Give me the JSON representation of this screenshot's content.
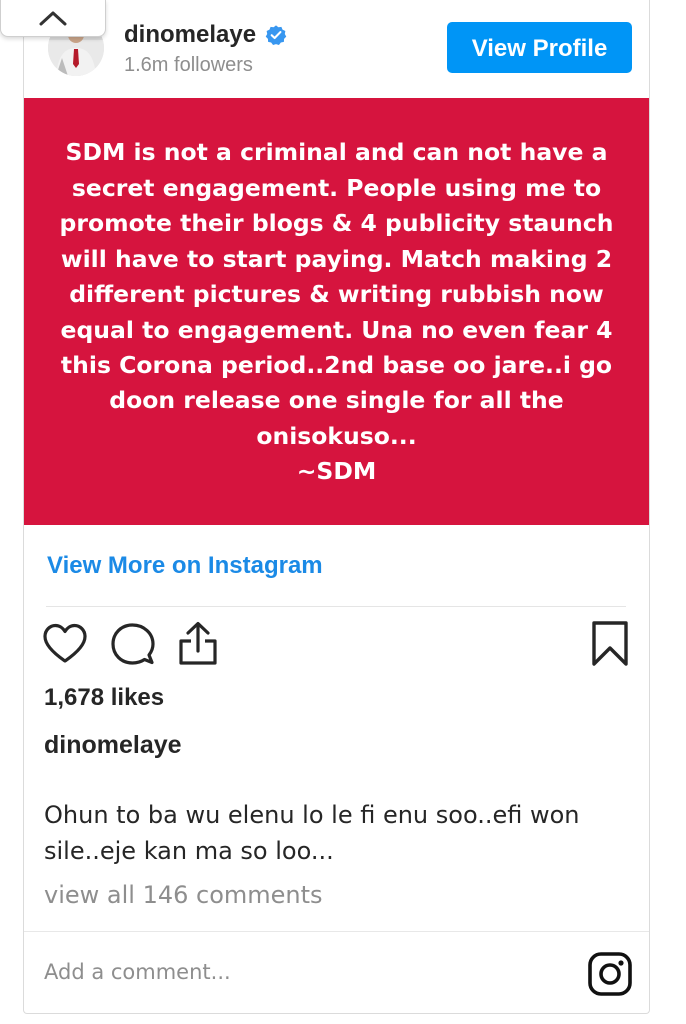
{
  "header": {
    "username": "dinomelaye",
    "followers": "1.6m followers",
    "view_profile_label": "View Profile"
  },
  "post": {
    "image_text_lines": [
      "SDM is not a criminal and can not have a",
      "secret engagement. People using me to",
      "promote their blogs & 4 publicity staunch",
      "will have to start paying. Match making 2",
      "different pictures & writing rubbish now",
      "equal to engagement. Una no even fear 4",
      "this Corona period..2nd base oo jare..i go",
      "doon release one single for all the",
      "onisokuso...",
      "~SDM"
    ],
    "image_background": "#d6143e",
    "view_more_label": "View More on Instagram",
    "likes": "1,678 likes",
    "caption_username": "dinomelaye",
    "caption_text": "Ohun to ba wu elenu lo le fi enu soo..efi won sile..eje kan ma so loo...",
    "view_comments": "view all 146 comments"
  },
  "comment_box": {
    "placeholder": "Add a comment..."
  },
  "icons": {
    "collapse": "chevron-up-icon",
    "verified": "verified-badge-icon",
    "like": "heart-icon",
    "comment": "comment-icon",
    "share": "share-icon",
    "save": "bookmark-icon",
    "instagram": "instagram-logo-icon"
  },
  "colors": {
    "accent": "#0095f6",
    "link": "#1b8ae6",
    "post_bg": "#d6143e"
  }
}
